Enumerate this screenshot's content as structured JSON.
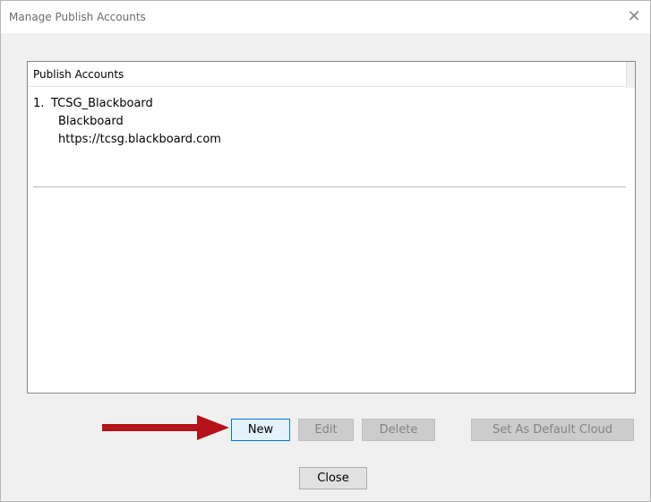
{
  "window": {
    "title": "Manage Publish Accounts",
    "close_glyph": "✕"
  },
  "panel": {
    "header": "Publish Accounts"
  },
  "accounts": [
    {
      "number": "1.",
      "name": "TCSG_Blackboard",
      "type": "Blackboard",
      "url": "https://tcsg.blackboard.com"
    }
  ],
  "buttons": {
    "new": "New",
    "edit": "Edit",
    "delete": "Delete",
    "set_default": "Set As Default Cloud",
    "close": "Close"
  },
  "colors": {
    "arrow": "#b5121b",
    "primary_border": "#0078d7"
  }
}
